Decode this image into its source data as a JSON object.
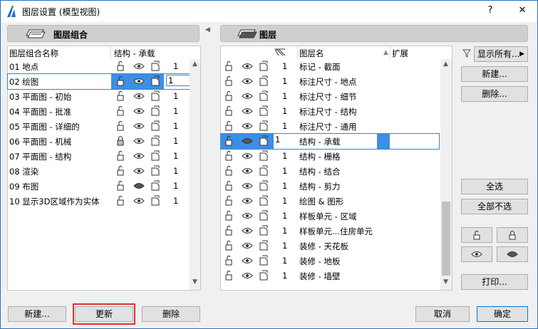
{
  "window": {
    "title": "图层设置 (模型视图)",
    "help": "?",
    "close": "✕"
  },
  "left": {
    "header": "图层组合",
    "col_name": "图层组合名称",
    "col_struct": "结构 - 承载",
    "rows": [
      {
        "name": "01 地点",
        "n": "1"
      },
      {
        "name": "02 绘图",
        "n": "1"
      },
      {
        "name": "03 平面图 - 初始",
        "n": "1"
      },
      {
        "name": "04 平面图 - 批准",
        "n": "1"
      },
      {
        "name": "05 平面图 - 详细的",
        "n": "1"
      },
      {
        "name": "06 平面图 - 机械",
        "n": "1"
      },
      {
        "name": "07 平面图 - 结构",
        "n": "1"
      },
      {
        "name": "08 渲染",
        "n": "1"
      },
      {
        "name": "09 布图",
        "n": "1"
      },
      {
        "name": "10 显示3D区域作为实体",
        "n": "1"
      }
    ],
    "new": "新建...",
    "update": "更新",
    "delete": "删除"
  },
  "right": {
    "header": "图层",
    "col_name": "图层名",
    "col_ext": "扩展",
    "rows": [
      {
        "n": "1",
        "name": "标记 - 截面"
      },
      {
        "n": "1",
        "name": "标注尺寸 - 地点"
      },
      {
        "n": "1",
        "name": "标注尺寸 - 细节"
      },
      {
        "n": "1",
        "name": "标注尺寸 - 结构"
      },
      {
        "n": "1",
        "name": "标注尺寸 - 通用"
      },
      {
        "n": "1",
        "name": "结构 - 承载"
      },
      {
        "n": "1",
        "name": "结构 - 栅格"
      },
      {
        "n": "1",
        "name": "结构 - 结合"
      },
      {
        "n": "1",
        "name": "结构 - 剪力"
      },
      {
        "n": "1",
        "name": "绘图 & 图形"
      },
      {
        "n": "1",
        "name": "样板单元 - 区域"
      },
      {
        "n": "1",
        "name": "样板单元...住房单元"
      },
      {
        "n": "1",
        "name": "装修 - 天花板"
      },
      {
        "n": "1",
        "name": "装修 - 地板"
      },
      {
        "n": "1",
        "name": "装修 - 墙壁"
      }
    ],
    "show_all": "显示所有...",
    "new": "新建...",
    "delete": "删除...",
    "select_all": "全选",
    "deselect_all": "全部不选",
    "print": "打印...",
    "cancel": "取消",
    "ok": "确定"
  }
}
